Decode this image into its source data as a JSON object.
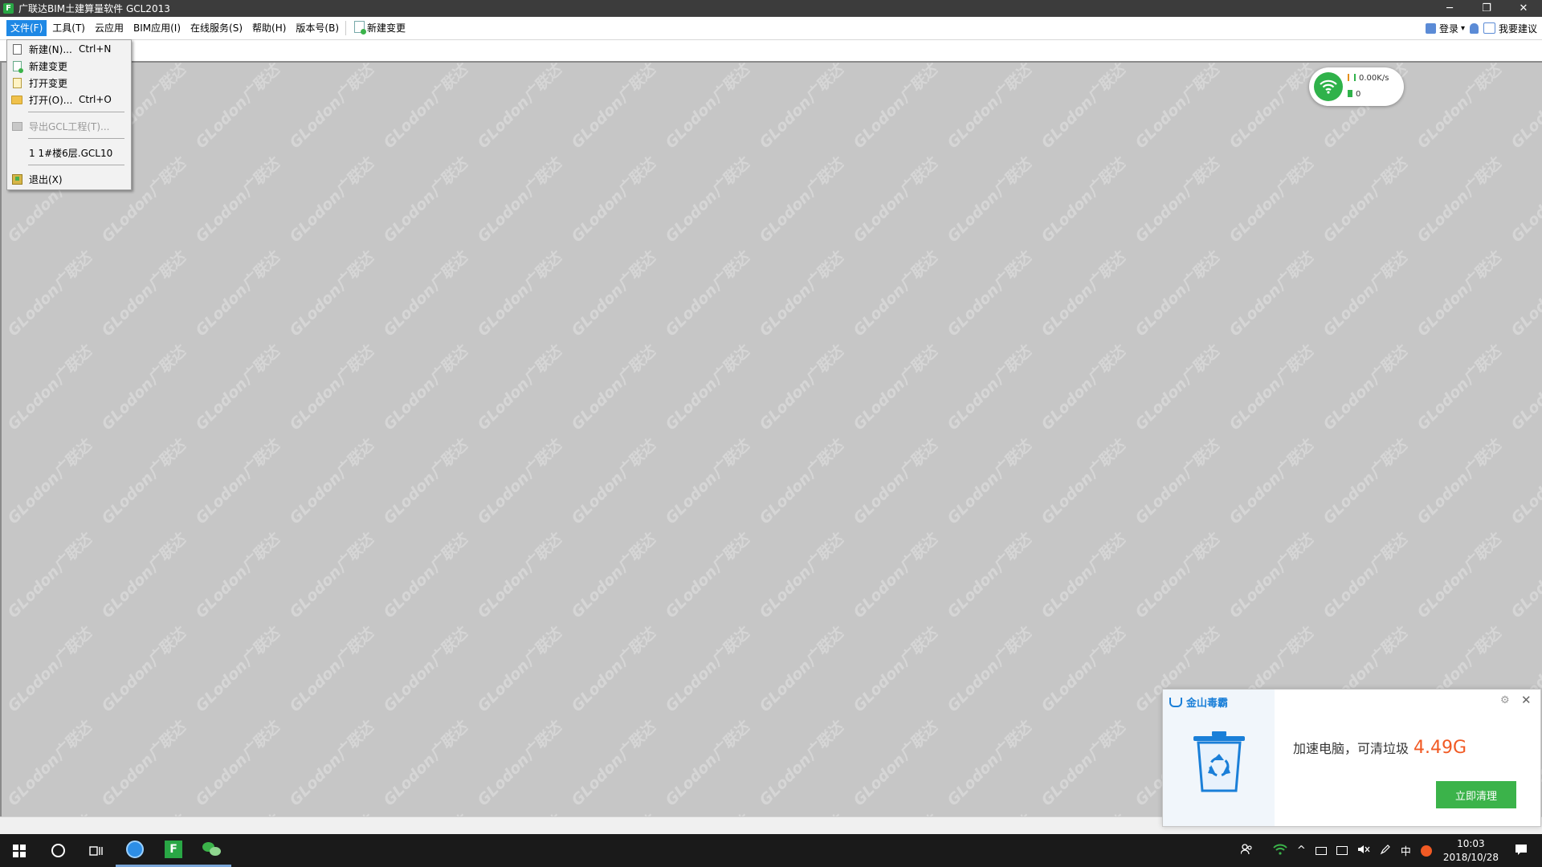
{
  "window": {
    "title": "广联达BIM土建算量软件 GCL2013",
    "logo_glyph": "F",
    "minimize": "─",
    "restore": "❐",
    "close": "✕"
  },
  "menubar": {
    "items": [
      "文件(F)",
      "工具(T)",
      "云应用",
      "BIM应用(I)",
      "在线服务(S)",
      "帮助(H)",
      "版本号(B)"
    ],
    "new_change": "新建变更",
    "login": "登录",
    "login_caret": "▾",
    "feedback": "我要建议"
  },
  "file_menu": {
    "items": [
      {
        "label": "新建(N)...",
        "shortcut": "Ctrl+N",
        "icon": "new-document-icon"
      },
      {
        "label": "新建变更",
        "shortcut": "",
        "icon": "new-change-icon"
      },
      {
        "label": "打开变更",
        "shortcut": "",
        "icon": "open-change-icon"
      },
      {
        "label": "打开(O)...",
        "shortcut": "Ctrl+O",
        "icon": "open-folder-icon"
      },
      {
        "label": "导出GCL工程(T)...",
        "shortcut": "",
        "icon": "export-icon",
        "disabled": true
      },
      {
        "label": "1 1#楼6层.GCL10",
        "shortcut": "",
        "icon": ""
      },
      {
        "label": "退出(X)",
        "shortcut": "",
        "icon": "exit-icon"
      }
    ]
  },
  "watermark": {
    "text": "GLodon广联达"
  },
  "net_widget": {
    "speed": "0.00K/s",
    "count": "0"
  },
  "popup": {
    "brand": "金山毒霸",
    "message": "加速电脑，可清垃圾",
    "size": "4.49G",
    "button": "立即清理",
    "gear": "⚙",
    "close": "✕"
  },
  "taskbar": {
    "time": "10:03",
    "date": "2018/10/28",
    "ime": "中",
    "caret": "^"
  },
  "colors": {
    "accent": "#1e88e5",
    "green": "#3bb34a",
    "orange": "#f15a24",
    "workspace": "#c6c6c6"
  }
}
